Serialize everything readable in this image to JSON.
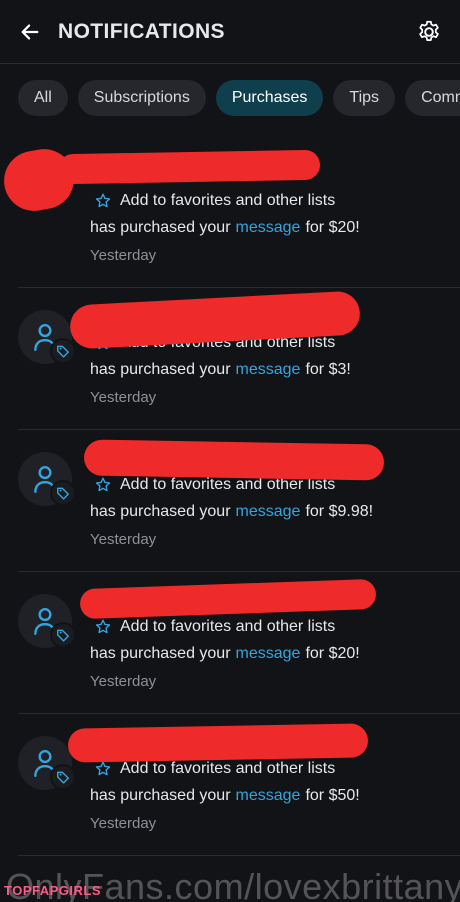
{
  "header": {
    "title": "NOTIFICATIONS"
  },
  "tabs": [
    {
      "label": "All"
    },
    {
      "label": "Subscriptions"
    },
    {
      "label": "Purchases"
    },
    {
      "label": "Tips"
    },
    {
      "label": "Comments"
    }
  ],
  "active_tab": "Purchases",
  "notifications": [
    {
      "favorites": "Add to favorites and other lists",
      "prefix": "has purchased your",
      "link": "message",
      "suffix": "for $20!",
      "time": "Yesterday"
    },
    {
      "favorites": "Add to favorites and other lists",
      "prefix": "has purchased your",
      "link": "message",
      "suffix": "for $3!",
      "time": "Yesterday"
    },
    {
      "favorites": "Add to favorites and other lists",
      "prefix": "has purchased your",
      "link": "message",
      "suffix": "for $9.98!",
      "time": "Yesterday"
    },
    {
      "favorites": "Add to favorites and other lists",
      "prefix": "has purchased your",
      "link": "message",
      "suffix": "for $20!",
      "time": "Yesterday"
    },
    {
      "favorites": "Add to favorites and other lists",
      "prefix": "has purchased your",
      "link": "message",
      "suffix": "for $50!",
      "time": "Yesterday"
    }
  ],
  "watermark": {
    "text": "OnlyFans.com/lovexbrittanyfr",
    "badge": "TOPFAPGIRLS"
  },
  "colors": {
    "accent": "#34a6df",
    "active_tab_bg": "#0f3f4d",
    "background": "#121316",
    "redaction": "#ee2a2a"
  }
}
